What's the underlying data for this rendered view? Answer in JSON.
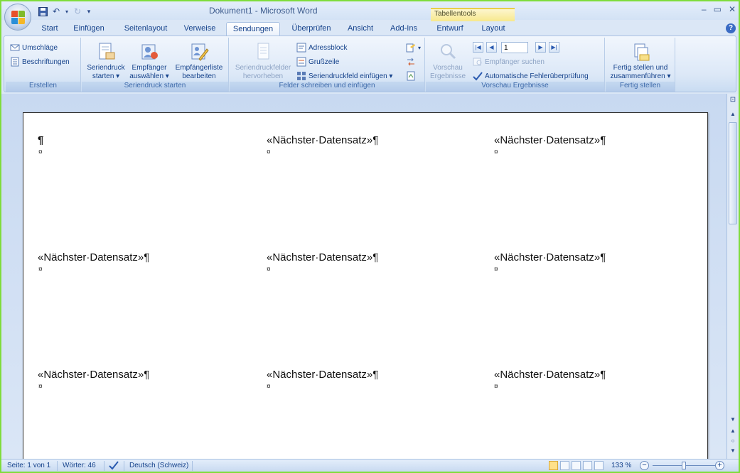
{
  "window": {
    "title": "Dokument1 - Microsoft Word",
    "contextual_tab_header": "Tabellentools",
    "controls": {
      "minimize": "–",
      "maximize": "▭",
      "close": "✕"
    }
  },
  "tabs": [
    {
      "label": "Start"
    },
    {
      "label": "Einfügen"
    },
    {
      "label": "Seitenlayout"
    },
    {
      "label": "Verweise"
    },
    {
      "label": "Sendungen",
      "active": true
    },
    {
      "label": "Überprüfen"
    },
    {
      "label": "Ansicht"
    },
    {
      "label": "Add-Ins"
    },
    {
      "label": "Entwurf"
    },
    {
      "label": "Layout"
    }
  ],
  "ribbon": {
    "erstellen": {
      "label": "Erstellen",
      "umschlaege": "Umschläge",
      "beschriftungen": "Beschriftungen"
    },
    "seriendruck_starten": {
      "label": "Seriendruck starten",
      "seriendruck_starten_btn": [
        "Seriendruck",
        "starten ▾"
      ],
      "empfaenger_auswaehlen": [
        "Empfänger",
        "auswählen ▾"
      ],
      "empfaengerliste_bearbeiten": [
        "Empfängerliste",
        "bearbeiten"
      ]
    },
    "felder": {
      "label": "Felder schreiben und einfügen",
      "seriendruckfelder_hervorheben": [
        "Seriendruckfelder",
        "hervorheben"
      ],
      "adressblock": "Adressblock",
      "grusszeile": "Grußzeile",
      "seriendruckfeld_einfuegen": "Seriendruckfeld einfügen ▾"
    },
    "vorschau": {
      "label": "Vorschau Ergebnisse",
      "vorschau_ergebnisse": [
        "Vorschau",
        "Ergebnisse"
      ],
      "record_number": "1",
      "empfaenger_suchen": "Empfänger suchen",
      "automatische_fehlerpruefung": "Automatische Fehlerüberprüfung"
    },
    "fertig": {
      "label": "Fertig stellen",
      "fertig_stellen": [
        "Fertig stellen und",
        "zusammenführen ▾"
      ]
    }
  },
  "document": {
    "first_cell": "¶",
    "cell_end_mark": "¤",
    "merge_field_text": "«Nächster·Datensatz»¶"
  },
  "statusbar": {
    "seite": "Seite: 1 von 1",
    "woerter": "Wörter: 46",
    "sprache": "Deutsch (Schweiz)",
    "zoom": "133 %"
  },
  "colors": {
    "ribbon_text": "#15428b",
    "active_view": "#ffe18a",
    "contextual_tab": "#f7e88c"
  }
}
